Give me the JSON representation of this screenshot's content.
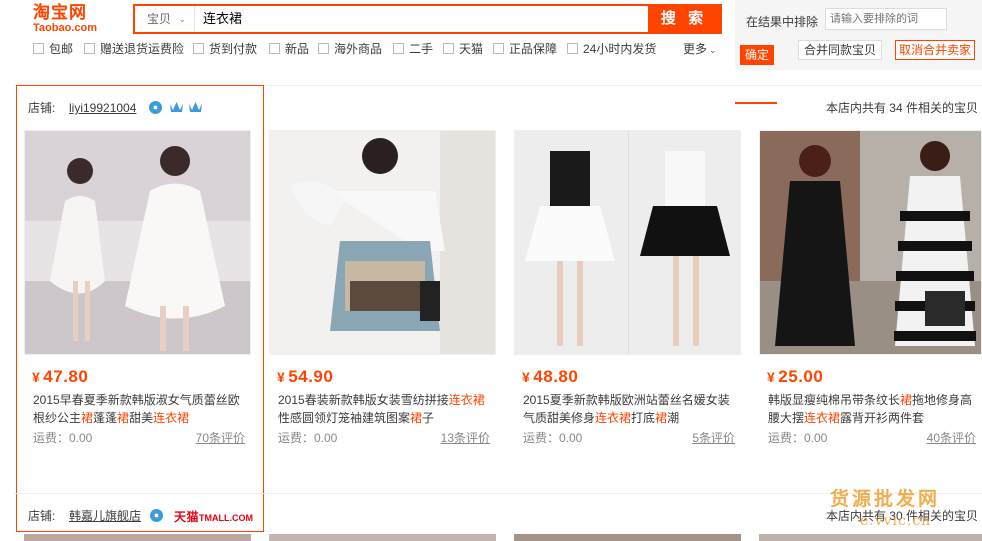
{
  "header": {
    "logo_cn": "淘宝网",
    "logo_en": "Taobao.com",
    "search_type": "宝贝",
    "search_query": "连衣裙",
    "search_button": "搜 索"
  },
  "filters": [
    {
      "label": "包邮"
    },
    {
      "label": "赠送退货运费险"
    },
    {
      "label": "货到付款"
    },
    {
      "label": "新品"
    },
    {
      "label": "海外商品"
    },
    {
      "label": "二手"
    },
    {
      "label": "天猫"
    },
    {
      "label": "正品保障"
    },
    {
      "label": "24小时内发货"
    }
  ],
  "more_label": "更多",
  "result_filter": {
    "label": "在结果中排除",
    "placeholder": "请输入要排除的词",
    "confirm": "确定",
    "merge": "合并同款宝贝",
    "unmerge": "取消合并卖家"
  },
  "shops": [
    {
      "label": "店铺:",
      "name": "liyi19921004",
      "count_text": "本店内共有 34 件相关的宝贝",
      "products": [
        {
          "price": "47.80",
          "yen": "¥",
          "desc_parts": [
            "2015早春夏季新款韩版淑女气质蕾丝欧根纱公主",
            "裙",
            "蓬蓬",
            "裙",
            "甜美",
            "连衣裙"
          ],
          "shipping": "运费：0.00",
          "reviews": "70条评价"
        },
        {
          "price": "54.90",
          "yen": "¥",
          "desc_parts": [
            "2015春装新款韩版女装雪纺拼接",
            "连衣裙",
            "性感圆领灯笼袖建筑图案",
            "裙",
            "子"
          ],
          "shipping": "运费：0.00",
          "reviews": "13条评价"
        },
        {
          "price": "48.80",
          "yen": "¥",
          "desc_parts": [
            "2015夏季新款韩版欧洲站蕾丝名媛女装气质甜美修身",
            "连衣裙",
            "打底",
            "裙",
            "潮"
          ],
          "shipping": "运费：0.00",
          "reviews": "5条评价"
        },
        {
          "price": "25.00",
          "yen": "¥",
          "desc_parts": [
            "韩版显瘦纯棉吊带条纹长",
            "裙",
            "拖地修身高腰大摆",
            "连衣裙",
            "露背开衫两件套"
          ],
          "shipping": "运费：0.00",
          "reviews": "40条评价"
        }
      ]
    },
    {
      "label": "店铺:",
      "name": "韩嘉儿旗舰店",
      "tmall": "天猫",
      "tmall_en": "TMALL.COM",
      "count_text": "本店内共有 30 件相关的宝贝"
    }
  ],
  "watermark_cn": "货源批发网",
  "watermark_en": "e.vvic.cn",
  "colors": {
    "accent": "#ff4400",
    "badge_blue": "#3b9bde"
  }
}
